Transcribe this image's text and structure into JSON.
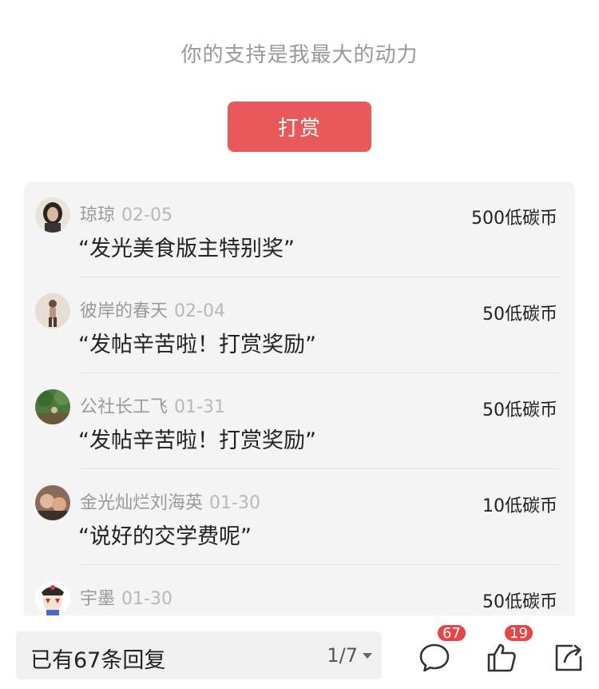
{
  "support": {
    "text": "你的支持是我最大的动力",
    "button_label": "打赏"
  },
  "rewards": [
    {
      "name": "琼琼",
      "date": "02-05",
      "amount": "500低碳币",
      "message": "“发光美食版主特别奖”",
      "avatar_icon": "avatar-girl-dark-hair"
    },
    {
      "name": "彼岸的春天",
      "date": "02-04",
      "amount": "50低碳币",
      "message": "“发帖辛苦啦！打赏奖励”",
      "avatar_icon": "avatar-standing-person"
    },
    {
      "name": "公社长工飞",
      "date": "01-31",
      "amount": "50低碳币",
      "message": "“发帖辛苦啦！打赏奖励”",
      "avatar_icon": "avatar-green-outdoor"
    },
    {
      "name": "金光灿烂刘海英",
      "date": "01-30",
      "amount": "10低碳币",
      "message": "“说好的交学费呢”",
      "avatar_icon": "avatar-two-people"
    },
    {
      "name": "宇墨",
      "date": "01-30",
      "amount": "50低碳币",
      "message": "",
      "avatar_icon": "avatar-opera-mask"
    }
  ],
  "bottom_bar": {
    "reply_count": "已有67条回复",
    "page": "1/7",
    "comment_badge": "67",
    "like_badge": "19"
  },
  "colors": {
    "accent": "#e85a5a",
    "badge": "#e84545",
    "panel": "#f4f4f4"
  }
}
